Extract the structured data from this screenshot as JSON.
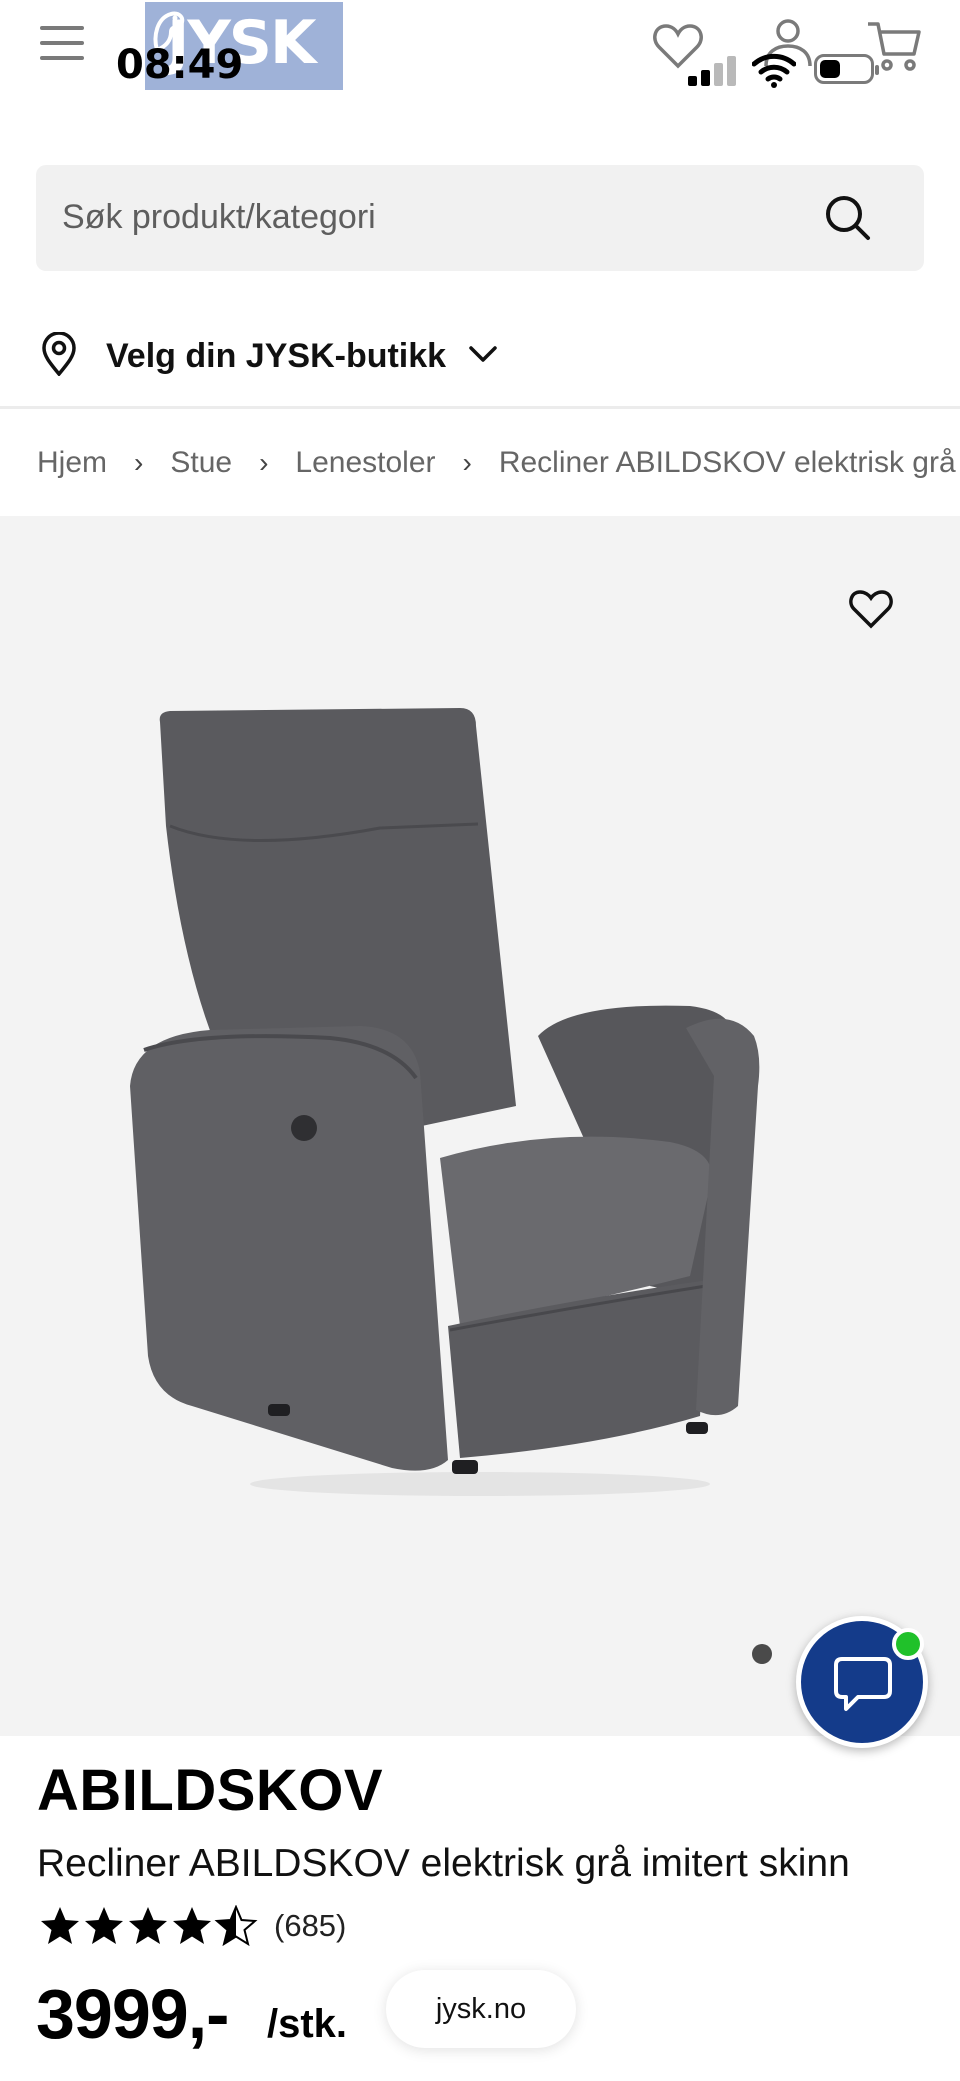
{
  "status_bar": {
    "time": "08:49"
  },
  "header": {
    "logo_text": "JYSK",
    "menu_icon": "hamburger-icon",
    "wishlist_icon": "heart-icon",
    "account_icon": "user-icon",
    "cart_icon": "cart-icon"
  },
  "search": {
    "placeholder": "Søk produkt/kategori",
    "icon": "search-icon"
  },
  "store_selector": {
    "label": "Velg din JYSK-butikk",
    "icon": "map-pin-icon"
  },
  "breadcrumb": [
    "Hjem",
    "Stue",
    "Lenestoler",
    "Recliner ABILDSKOV elektrisk grå"
  ],
  "product": {
    "brand": "ABILDSKOV",
    "name": "Recliner ABILDSKOV elektrisk grå imitert skinn",
    "rating": 4.5,
    "rating_max": 5,
    "review_count": "(685)",
    "price": "3999,-",
    "unit": "/stk."
  },
  "gallery": {
    "image_index": 1
  },
  "chat": {
    "icon": "chat-bubble-icon",
    "online": true
  },
  "browser": {
    "url": "jysk.no"
  },
  "colors": {
    "brand_blue": "#143b8a",
    "online_green": "#20c12a",
    "gallery_bg": "#f3f3f3"
  }
}
